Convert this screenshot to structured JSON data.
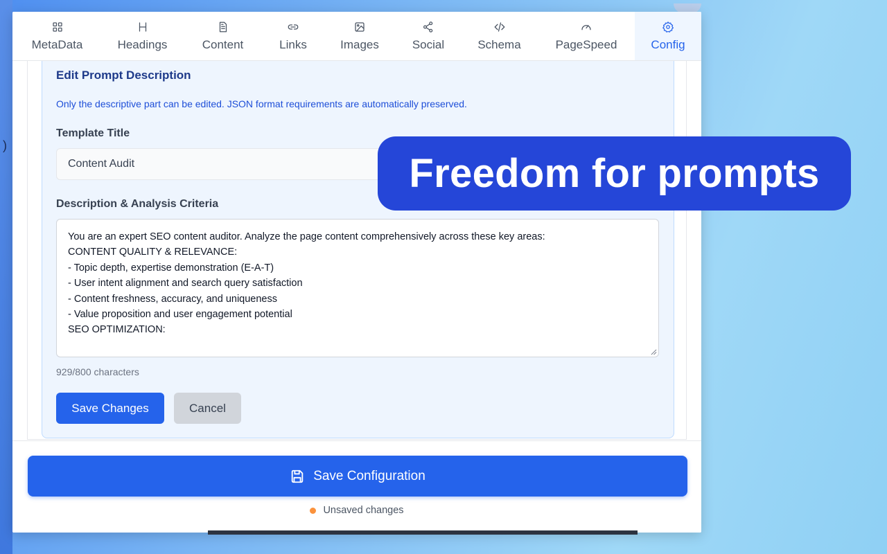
{
  "tabs": [
    {
      "label": "MetaData",
      "icon": "grid-icon"
    },
    {
      "label": "Headings",
      "icon": "heading-icon"
    },
    {
      "label": "Content",
      "icon": "document-icon"
    },
    {
      "label": "Links",
      "icon": "link-icon"
    },
    {
      "label": "Images",
      "icon": "image-icon"
    },
    {
      "label": "Social",
      "icon": "share-icon"
    },
    {
      "label": "Schema",
      "icon": "code-icon"
    },
    {
      "label": "PageSpeed",
      "icon": "gauge-icon"
    },
    {
      "label": "Config",
      "icon": "gear-icon",
      "active": true
    }
  ],
  "edit": {
    "title": "Edit Prompt Description",
    "note": "Only the descriptive part can be edited. JSON format requirements are automatically preserved.",
    "template_title_label": "Template Title",
    "template_title_value": "Content Audit",
    "description_label": "Description & Analysis Criteria",
    "description_lines": [
      "You are an expert SEO content auditor. Analyze the page content comprehensively across these key areas:",
      "",
      "CONTENT QUALITY & RELEVANCE:",
      "- Topic depth, expertise demonstration (E-A-T)",
      "- User intent alignment and search query satisfaction",
      "- Content freshness, accuracy, and uniqueness",
      "- Value proposition and user engagement potential",
      "",
      "SEO OPTIMIZATION:"
    ],
    "char_count": "929/800 characters",
    "save_label": "Save Changes",
    "cancel_label": "Cancel"
  },
  "footer": {
    "save_config_label": "Save Configuration",
    "save_config_icon": "floppy-disk-icon",
    "status_text": "Unsaved changes",
    "status_color": "#fb923c"
  },
  "banner": {
    "text": "Freedom for prompts"
  },
  "colors": {
    "accent": "#2563eb",
    "banner": "#2546d8"
  }
}
